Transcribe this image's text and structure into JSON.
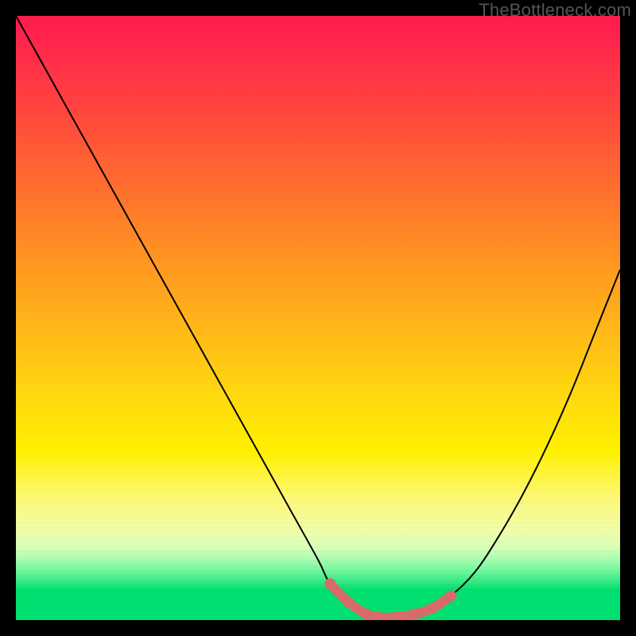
{
  "watermark": {
    "text": "TheBottleneck.com"
  },
  "colors": {
    "curve": "#000000",
    "marker_stroke": "#d76a6a",
    "marker_fill": "#d76a6a"
  },
  "chart_data": {
    "type": "line",
    "title": "",
    "xlabel": "",
    "ylabel": "",
    "xlim": [
      0,
      100
    ],
    "ylim": [
      0,
      100
    ],
    "grid": false,
    "legend": false,
    "series": [
      {
        "name": "bottleneck-curve",
        "x": [
          0,
          5,
          10,
          15,
          20,
          25,
          30,
          35,
          40,
          45,
          50,
          52,
          55,
          58,
          60,
          63,
          66,
          69,
          72,
          76,
          80,
          84,
          88,
          92,
          96,
          100
        ],
        "values": [
          100,
          91,
          82,
          73,
          64,
          55,
          46,
          37,
          28,
          19,
          10,
          6,
          3,
          1,
          0.5,
          0.5,
          1,
          2,
          4,
          8,
          14,
          21,
          29,
          38,
          48,
          58
        ]
      }
    ],
    "markers": {
      "name": "trough-band",
      "x": [
        52,
        55,
        58,
        60,
        63,
        66,
        69,
        72
      ],
      "values": [
        6,
        3,
        1,
        0.5,
        0.5,
        1,
        2,
        4
      ],
      "style": "thick-pink"
    }
  }
}
